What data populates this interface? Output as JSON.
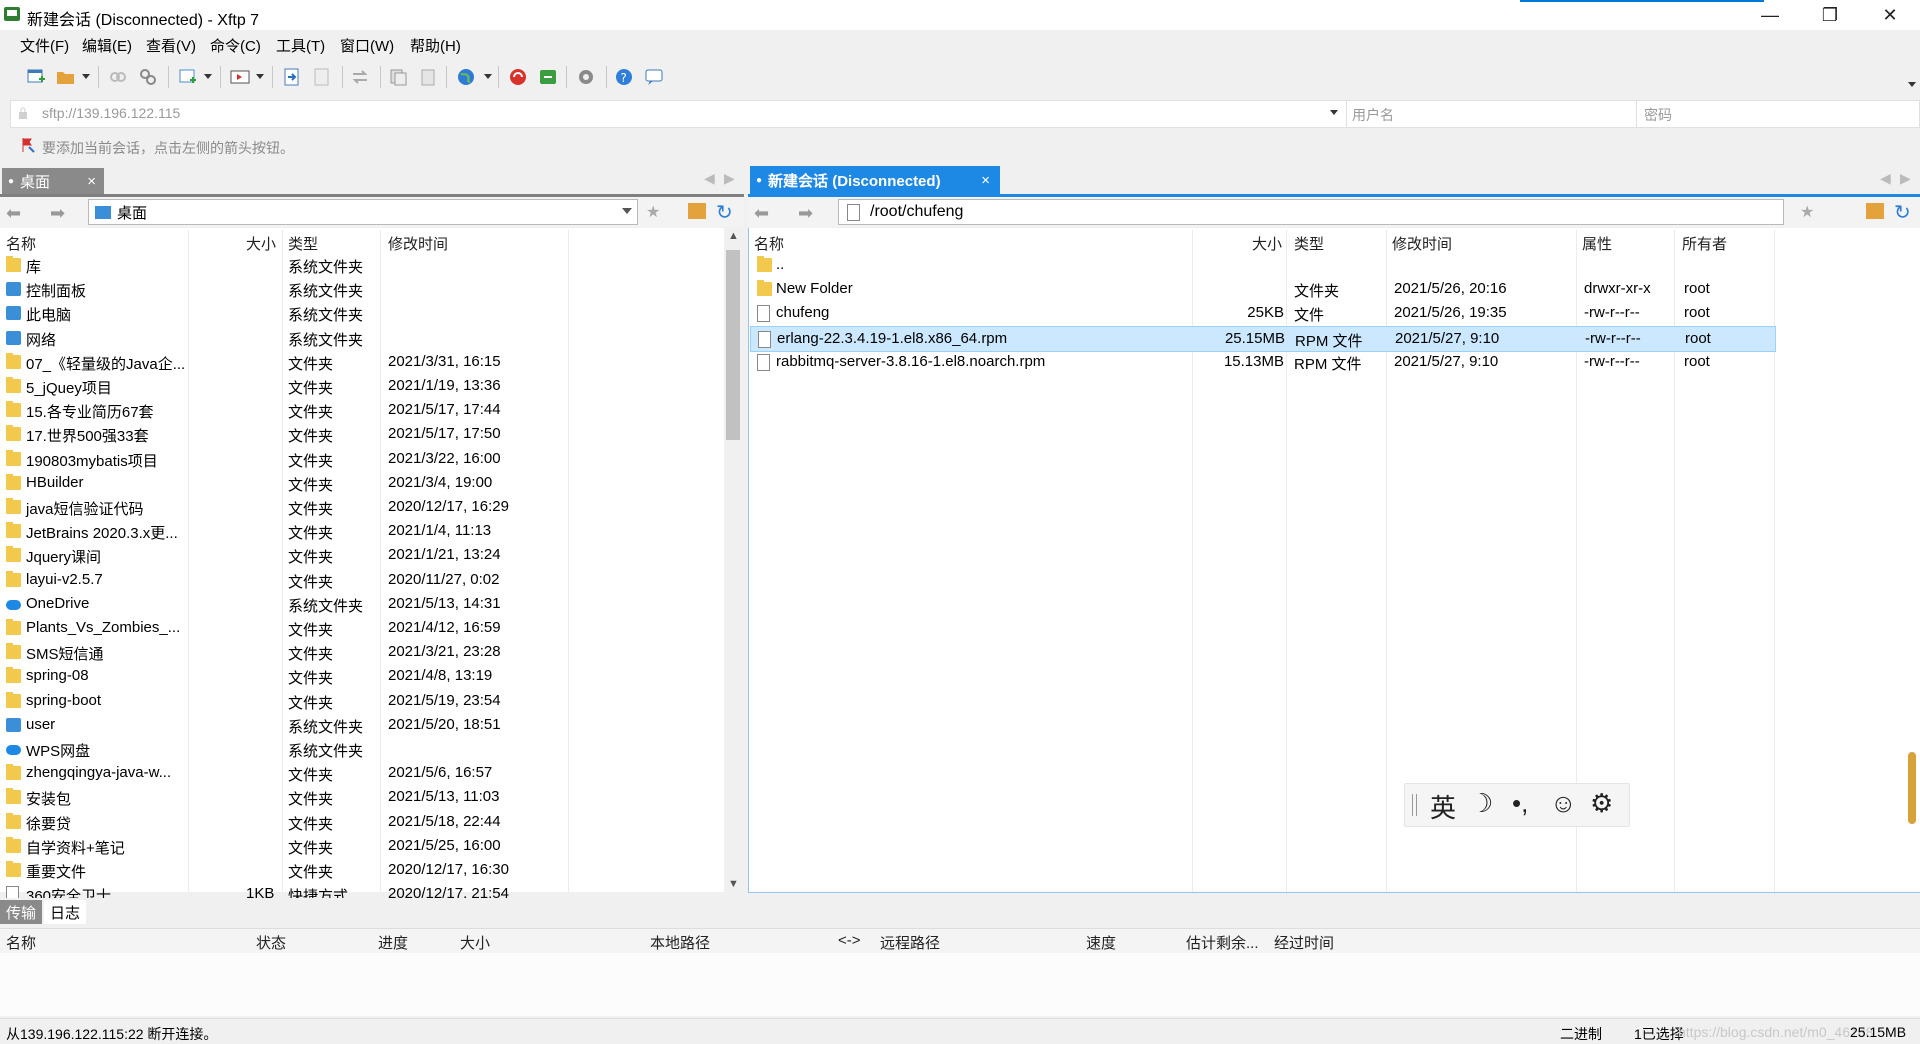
{
  "window": {
    "title": "新建会话 (Disconnected) - Xftp 7",
    "controls": [
      "—",
      "❐",
      "✕"
    ]
  },
  "menu": [
    "文件(F)",
    "编辑(E)",
    "查看(V)",
    "命令(C)",
    "工具(T)",
    "窗口(W)",
    "帮助(H)"
  ],
  "address": {
    "url_placeholder": "sftp://139.196.122.115",
    "username_placeholder": "用户名",
    "password_placeholder": "密码",
    "hint": "要添加当前会话，点击左侧的箭头按钮。"
  },
  "left_pane": {
    "tab_label": "桌面",
    "tab_close": "×",
    "path": "桌面",
    "columns": [
      "名称",
      "大小",
      "类型",
      "修改时间"
    ],
    "files": [
      {
        "name": "库",
        "size": "",
        "type": "系统文件夹",
        "modified": "",
        "icon": "library-icon"
      },
      {
        "name": "控制面板",
        "size": "",
        "type": "系统文件夹",
        "modified": "",
        "icon": "control-panel-icon"
      },
      {
        "name": "此电脑",
        "size": "",
        "type": "系统文件夹",
        "modified": "",
        "icon": "computer-icon"
      },
      {
        "name": "网络",
        "size": "",
        "type": "系统文件夹",
        "modified": "",
        "icon": "network-icon"
      },
      {
        "name": "07_《轻量级的Java企...",
        "size": "",
        "type": "文件夹",
        "modified": "2021/3/31, 16:15",
        "icon": "folder-icon"
      },
      {
        "name": "5_jQuey项目",
        "size": "",
        "type": "文件夹",
        "modified": "2021/1/19, 13:36",
        "icon": "folder-icon"
      },
      {
        "name": "15.各专业简历67套",
        "size": "",
        "type": "文件夹",
        "modified": "2021/5/17, 17:44",
        "icon": "folder-icon"
      },
      {
        "name": "17.世界500强33套",
        "size": "",
        "type": "文件夹",
        "modified": "2021/5/17, 17:50",
        "icon": "folder-icon"
      },
      {
        "name": "190803mybatis项目",
        "size": "",
        "type": "文件夹",
        "modified": "2021/3/22, 16:00",
        "icon": "folder-icon"
      },
      {
        "name": "HBuilder",
        "size": "",
        "type": "文件夹",
        "modified": "2021/3/4, 19:00",
        "icon": "folder-icon"
      },
      {
        "name": "java短信验证代码",
        "size": "",
        "type": "文件夹",
        "modified": "2020/12/17, 16:29",
        "icon": "folder-icon"
      },
      {
        "name": "JetBrains 2020.3.x更...",
        "size": "",
        "type": "文件夹",
        "modified": "2021/1/4, 11:13",
        "icon": "folder-icon"
      },
      {
        "name": "Jquery课间",
        "size": "",
        "type": "文件夹",
        "modified": "2021/1/21, 13:24",
        "icon": "folder-icon"
      },
      {
        "name": "layui-v2.5.7",
        "size": "",
        "type": "文件夹",
        "modified": "2020/11/27, 0:02",
        "icon": "folder-icon"
      },
      {
        "name": "OneDrive",
        "size": "",
        "type": "系统文件夹",
        "modified": "2021/5/13, 14:31",
        "icon": "cloud-icon"
      },
      {
        "name": "Plants_Vs_Zombies_...",
        "size": "",
        "type": "文件夹",
        "modified": "2021/4/12, 16:59",
        "icon": "folder-icon"
      },
      {
        "name": "SMS短信通",
        "size": "",
        "type": "文件夹",
        "modified": "2021/3/21, 23:28",
        "icon": "folder-icon"
      },
      {
        "name": "spring-08",
        "size": "",
        "type": "文件夹",
        "modified": "2021/4/8, 13:19",
        "icon": "folder-icon"
      },
      {
        "name": "spring-boot",
        "size": "",
        "type": "文件夹",
        "modified": "2021/5/19, 23:54",
        "icon": "folder-icon"
      },
      {
        "name": "user",
        "size": "",
        "type": "系统文件夹",
        "modified": "2021/5/20, 18:51",
        "icon": "user-icon"
      },
      {
        "name": "WPS网盘",
        "size": "",
        "type": "系统文件夹",
        "modified": "",
        "icon": "cloud-icon"
      },
      {
        "name": "zhengqingya-java-w...",
        "size": "",
        "type": "文件夹",
        "modified": "2021/5/6, 16:57",
        "icon": "folder-icon"
      },
      {
        "name": "安装包",
        "size": "",
        "type": "文件夹",
        "modified": "2021/5/13, 11:03",
        "icon": "folder-icon"
      },
      {
        "name": "徐要贷",
        "size": "",
        "type": "文件夹",
        "modified": "2021/5/18, 22:44",
        "icon": "folder-icon"
      },
      {
        "name": "自学资料+笔记",
        "size": "",
        "type": "文件夹",
        "modified": "2021/5/25, 16:00",
        "icon": "folder-icon"
      },
      {
        "name": "重要文件",
        "size": "",
        "type": "文件夹",
        "modified": "2020/12/17, 16:30",
        "icon": "folder-icon"
      },
      {
        "name": "360安全卫士",
        "size": "1KB",
        "type": "快捷方式",
        "modified": "2020/12/17, 21:54",
        "icon": "shortcut-icon"
      }
    ]
  },
  "right_pane": {
    "tab_label": "新建会话 (Disconnected)",
    "tab_close": "×",
    "path": "/root/chufeng",
    "columns": [
      "名称",
      "大小",
      "类型",
      "修改时间",
      "属性",
      "所有者"
    ],
    "files": [
      {
        "name": "..",
        "size": "",
        "type": "",
        "modified": "",
        "attr": "",
        "owner": "",
        "icon": "folder-icon"
      },
      {
        "name": "New Folder",
        "size": "",
        "type": "文件夹",
        "modified": "2021/5/26, 20:16",
        "attr": "drwxr-xr-x",
        "owner": "root",
        "icon": "folder-icon"
      },
      {
        "name": "chufeng",
        "size": "25KB",
        "type": "文件",
        "modified": "2021/5/26, 19:35",
        "attr": "-rw-r--r--",
        "owner": "root",
        "icon": "file-icon"
      },
      {
        "name": "erlang-22.3.4.19-1.el8.x86_64.rpm",
        "size": "25.15MB",
        "type": "RPM 文件",
        "modified": "2021/5/27, 9:10",
        "attr": "-rw-r--r--",
        "owner": "root",
        "icon": "file-icon",
        "selected": true
      },
      {
        "name": "rabbitmq-server-3.8.16-1.el8.noarch.rpm",
        "size": "15.13MB",
        "type": "RPM 文件",
        "modified": "2021/5/27, 9:10",
        "attr": "-rw-r--r--",
        "owner": "root",
        "icon": "file-icon"
      }
    ]
  },
  "ime": [
    "英",
    "☽",
    "•,",
    "☺",
    "⚙"
  ],
  "bottom_tabs": [
    "传输",
    "日志"
  ],
  "transfer_columns": [
    "名称",
    "状态",
    "进度",
    "大小",
    "本地路径",
    "<->",
    "远程路径",
    "速度",
    "估计剩余...",
    "经过时间"
  ],
  "status": {
    "message": "从139.196.122.115:22 断开连接。",
    "mode": "二进制",
    "selection": "1已选择",
    "size": "25.15MB",
    "watermark": "https://blog.csdn.net/m0_46188"
  },
  "colors": {
    "tab_active": "#1e88e5",
    "tab_inactive": "#8a8a8a",
    "selection": "#cce8ff"
  }
}
